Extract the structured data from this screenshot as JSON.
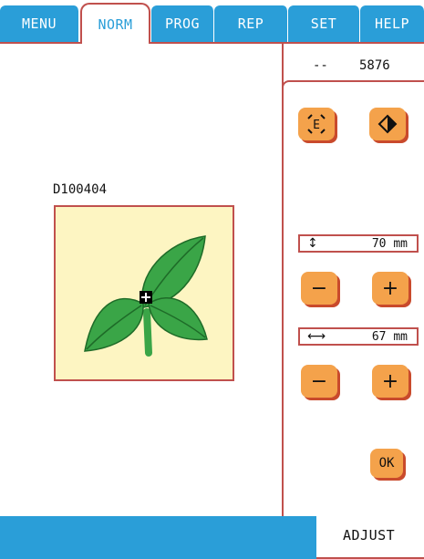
{
  "tabs": [
    {
      "label": "MENU"
    },
    {
      "label": "NORM"
    },
    {
      "label": "PROG"
    },
    {
      "label": "REP"
    },
    {
      "label": "SET"
    },
    {
      "label": "HELP"
    }
  ],
  "active_tab": "NORM",
  "status": {
    "dash": "--",
    "stitch_count": "5876"
  },
  "pattern": {
    "name": "D100404"
  },
  "controls": {
    "edit_icon": "e-arrows-icon",
    "trace_icon": "diamond-icon",
    "height_value": "70 mm",
    "height_icon": "vertical-arrow-icon",
    "width_value": "67 mm",
    "width_icon": "horizontal-arrow-icon",
    "minus": "−",
    "plus": "+",
    "ok": "OK"
  },
  "footer": {
    "mode_label": "ADJUST"
  },
  "colors": {
    "tab_blue": "#2a9ed8",
    "frame_red": "#c0504d",
    "button_orange": "#f4a24b",
    "preview_bg": "#fdf5c2",
    "leaf_green": "#3aa547"
  }
}
